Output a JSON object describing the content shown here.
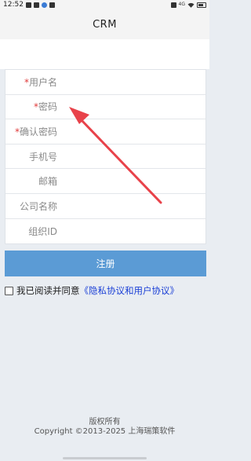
{
  "status_bar": {
    "time": "12:52",
    "network": "4G",
    "battery_icon": "battery-icon",
    "wifi_icon": "wifi-icon"
  },
  "header": {
    "title": "CRM"
  },
  "form": {
    "fields": [
      {
        "required": "*",
        "label": "用户名",
        "value": ""
      },
      {
        "required": "*",
        "label": "密码",
        "value": ""
      },
      {
        "required": "*",
        "label": "确认密码",
        "value": ""
      },
      {
        "required": "",
        "label": "手机号",
        "value": ""
      },
      {
        "required": "",
        "label": "邮箱",
        "value": ""
      },
      {
        "required": "",
        "label": "公司名称",
        "value": ""
      },
      {
        "required": "",
        "label": "组织ID",
        "value": ""
      }
    ]
  },
  "register_button": {
    "label": "注册"
  },
  "agreement": {
    "checked": false,
    "text": "我已阅读并同意",
    "link": "《隐私协议和用户协议》"
  },
  "footer": {
    "rights": "版权所有",
    "copyright": "Copyright ©2013-2025 上海瑞策软件"
  },
  "colors": {
    "accent": "#5b9bd5",
    "required": "#e03a3a",
    "link": "#1a3fd6",
    "annotation_arrow": "#e8424a",
    "background": "#e9edf2"
  }
}
